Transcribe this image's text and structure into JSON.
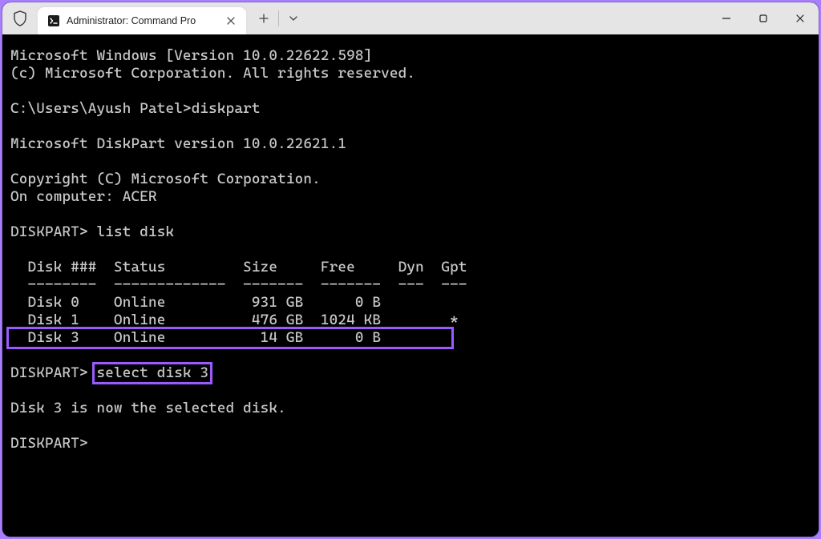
{
  "titlebar": {
    "tab_title": "Administrator: Command Pro",
    "shield_icon": "shield",
    "cmd_icon": "cmd"
  },
  "terminal": {
    "line1": "Microsoft Windows [Version 10.0.22622.598]",
    "line2": "(c) Microsoft Corporation. All rights reserved.",
    "prompt1_path": "C:\\Users\\Ayush Patel>",
    "prompt1_cmd": "diskpart",
    "dp_version": "Microsoft DiskPart version 10.0.22621.1",
    "copyright": "Copyright (C) Microsoft Corporation.",
    "computer": "On computer: ACER",
    "dp_prompt": "DISKPART>",
    "cmd_list": "list disk",
    "table": {
      "header": "  Disk ###  Status         Size     Free     Dyn  Gpt",
      "divider": "  --------  -------------  -------  -------  ---  ---",
      "rows": [
        "  Disk 0    Online          931 GB      0 B",
        "  Disk 1    Online          476 GB  1024 KB        *",
        "  Disk 3    Online           14 GB      0 B        "
      ]
    },
    "cmd_select": "select disk 3",
    "result": "Disk 3 is now the selected disk.",
    "final_prompt": "DISKPART>"
  }
}
